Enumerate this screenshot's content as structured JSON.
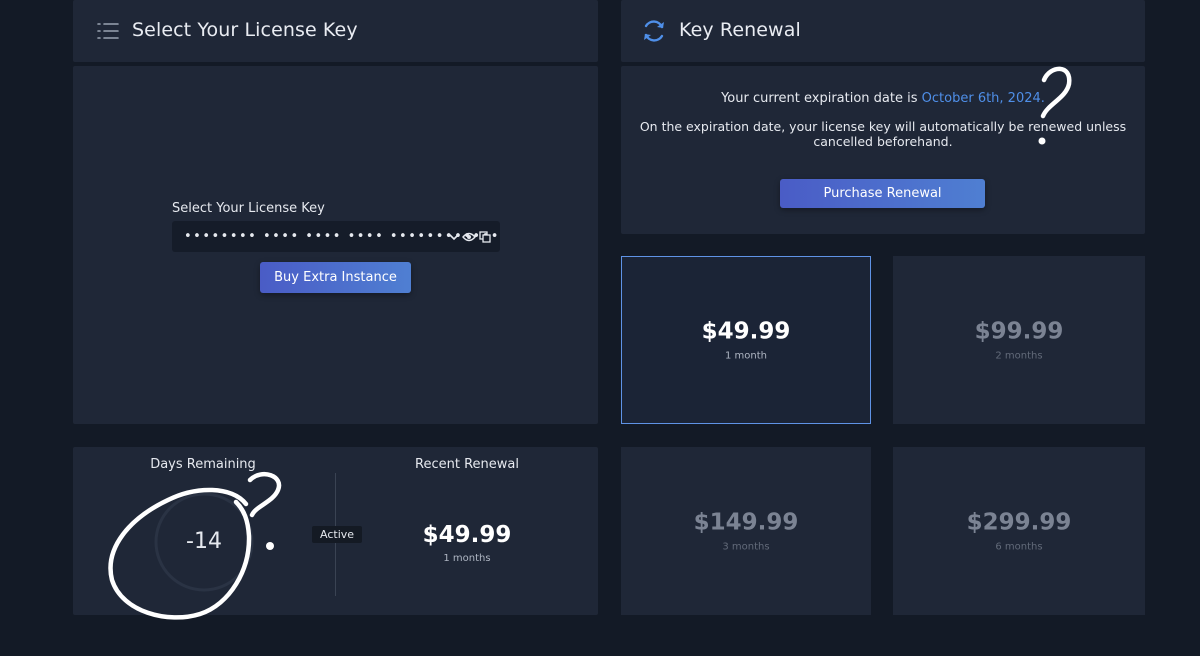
{
  "license_panel": {
    "title": "Select Your License Key",
    "select_label": "Select Your License Key",
    "license_key_masked": "•••••••• •••• •••• •••• ••••••••••••",
    "buy_button": "Buy Extra Instance"
  },
  "renewal_panel": {
    "title": "Key Renewal",
    "expiration_prefix": "Your current expiration date is",
    "expiration_date": "October 6th, 2024.",
    "auto_renew_line1": "On the expiration date, your license key will automatically be renewed unless",
    "auto_renew_line2": "cancelled beforehand.",
    "purchase_button": "Purchase Renewal"
  },
  "status_panel": {
    "days_label": "Days Remaining",
    "days_value": "-14",
    "status_badge": "Active",
    "recent_label": "Recent Renewal",
    "recent_price": "$49.99",
    "recent_period": "1 months"
  },
  "plans": [
    {
      "price": "$49.99",
      "period": "1 month",
      "selected": true
    },
    {
      "price": "$99.99",
      "period": "2 months",
      "selected": false
    },
    {
      "price": "$149.99",
      "period": "3 months",
      "selected": false
    },
    {
      "price": "$299.99",
      "period": "6 months",
      "selected": false
    }
  ],
  "colors": {
    "background": "#131a26",
    "panel": "#1f2737",
    "accent": "#5f93e6",
    "highlight_text": "#4f8fe8"
  },
  "icons": {
    "license_header": "list-icon",
    "renewal_header": "refresh-icon",
    "dropdown": "chevron-down-icon",
    "reveal": "eye-icon",
    "copy": "copy-icon"
  }
}
